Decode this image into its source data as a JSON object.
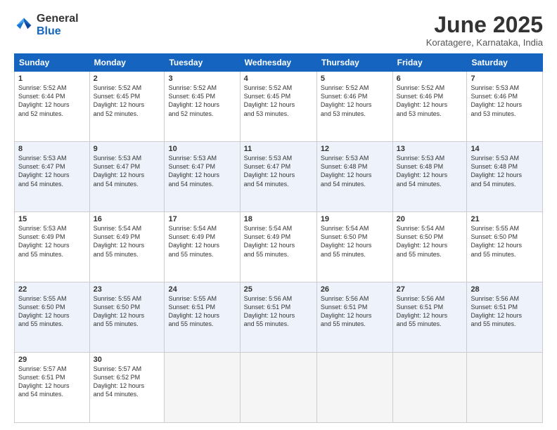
{
  "logo": {
    "general": "General",
    "blue": "Blue"
  },
  "title": "June 2025",
  "location": "Koratagere, Karnataka, India",
  "headers": [
    "Sunday",
    "Monday",
    "Tuesday",
    "Wednesday",
    "Thursday",
    "Friday",
    "Saturday"
  ],
  "rows": [
    [
      {
        "day": "1",
        "info": "Sunrise: 5:52 AM\nSunset: 6:44 PM\nDaylight: 12 hours\nand 52 minutes."
      },
      {
        "day": "2",
        "info": "Sunrise: 5:52 AM\nSunset: 6:45 PM\nDaylight: 12 hours\nand 52 minutes."
      },
      {
        "day": "3",
        "info": "Sunrise: 5:52 AM\nSunset: 6:45 PM\nDaylight: 12 hours\nand 52 minutes."
      },
      {
        "day": "4",
        "info": "Sunrise: 5:52 AM\nSunset: 6:45 PM\nDaylight: 12 hours\nand 53 minutes."
      },
      {
        "day": "5",
        "info": "Sunrise: 5:52 AM\nSunset: 6:46 PM\nDaylight: 12 hours\nand 53 minutes."
      },
      {
        "day": "6",
        "info": "Sunrise: 5:52 AM\nSunset: 6:46 PM\nDaylight: 12 hours\nand 53 minutes."
      },
      {
        "day": "7",
        "info": "Sunrise: 5:53 AM\nSunset: 6:46 PM\nDaylight: 12 hours\nand 53 minutes."
      }
    ],
    [
      {
        "day": "8",
        "info": "Sunrise: 5:53 AM\nSunset: 6:47 PM\nDaylight: 12 hours\nand 54 minutes."
      },
      {
        "day": "9",
        "info": "Sunrise: 5:53 AM\nSunset: 6:47 PM\nDaylight: 12 hours\nand 54 minutes."
      },
      {
        "day": "10",
        "info": "Sunrise: 5:53 AM\nSunset: 6:47 PM\nDaylight: 12 hours\nand 54 minutes."
      },
      {
        "day": "11",
        "info": "Sunrise: 5:53 AM\nSunset: 6:47 PM\nDaylight: 12 hours\nand 54 minutes."
      },
      {
        "day": "12",
        "info": "Sunrise: 5:53 AM\nSunset: 6:48 PM\nDaylight: 12 hours\nand 54 minutes."
      },
      {
        "day": "13",
        "info": "Sunrise: 5:53 AM\nSunset: 6:48 PM\nDaylight: 12 hours\nand 54 minutes."
      },
      {
        "day": "14",
        "info": "Sunrise: 5:53 AM\nSunset: 6:48 PM\nDaylight: 12 hours\nand 54 minutes."
      }
    ],
    [
      {
        "day": "15",
        "info": "Sunrise: 5:53 AM\nSunset: 6:49 PM\nDaylight: 12 hours\nand 55 minutes."
      },
      {
        "day": "16",
        "info": "Sunrise: 5:54 AM\nSunset: 6:49 PM\nDaylight: 12 hours\nand 55 minutes."
      },
      {
        "day": "17",
        "info": "Sunrise: 5:54 AM\nSunset: 6:49 PM\nDaylight: 12 hours\nand 55 minutes."
      },
      {
        "day": "18",
        "info": "Sunrise: 5:54 AM\nSunset: 6:49 PM\nDaylight: 12 hours\nand 55 minutes."
      },
      {
        "day": "19",
        "info": "Sunrise: 5:54 AM\nSunset: 6:50 PM\nDaylight: 12 hours\nand 55 minutes."
      },
      {
        "day": "20",
        "info": "Sunrise: 5:54 AM\nSunset: 6:50 PM\nDaylight: 12 hours\nand 55 minutes."
      },
      {
        "day": "21",
        "info": "Sunrise: 5:55 AM\nSunset: 6:50 PM\nDaylight: 12 hours\nand 55 minutes."
      }
    ],
    [
      {
        "day": "22",
        "info": "Sunrise: 5:55 AM\nSunset: 6:50 PM\nDaylight: 12 hours\nand 55 minutes."
      },
      {
        "day": "23",
        "info": "Sunrise: 5:55 AM\nSunset: 6:50 PM\nDaylight: 12 hours\nand 55 minutes."
      },
      {
        "day": "24",
        "info": "Sunrise: 5:55 AM\nSunset: 6:51 PM\nDaylight: 12 hours\nand 55 minutes."
      },
      {
        "day": "25",
        "info": "Sunrise: 5:56 AM\nSunset: 6:51 PM\nDaylight: 12 hours\nand 55 minutes."
      },
      {
        "day": "26",
        "info": "Sunrise: 5:56 AM\nSunset: 6:51 PM\nDaylight: 12 hours\nand 55 minutes."
      },
      {
        "day": "27",
        "info": "Sunrise: 5:56 AM\nSunset: 6:51 PM\nDaylight: 12 hours\nand 55 minutes."
      },
      {
        "day": "28",
        "info": "Sunrise: 5:56 AM\nSunset: 6:51 PM\nDaylight: 12 hours\nand 55 minutes."
      }
    ],
    [
      {
        "day": "29",
        "info": "Sunrise: 5:57 AM\nSunset: 6:51 PM\nDaylight: 12 hours\nand 54 minutes."
      },
      {
        "day": "30",
        "info": "Sunrise: 5:57 AM\nSunset: 6:52 PM\nDaylight: 12 hours\nand 54 minutes."
      },
      {
        "day": "",
        "info": ""
      },
      {
        "day": "",
        "info": ""
      },
      {
        "day": "",
        "info": ""
      },
      {
        "day": "",
        "info": ""
      },
      {
        "day": "",
        "info": ""
      }
    ]
  ]
}
